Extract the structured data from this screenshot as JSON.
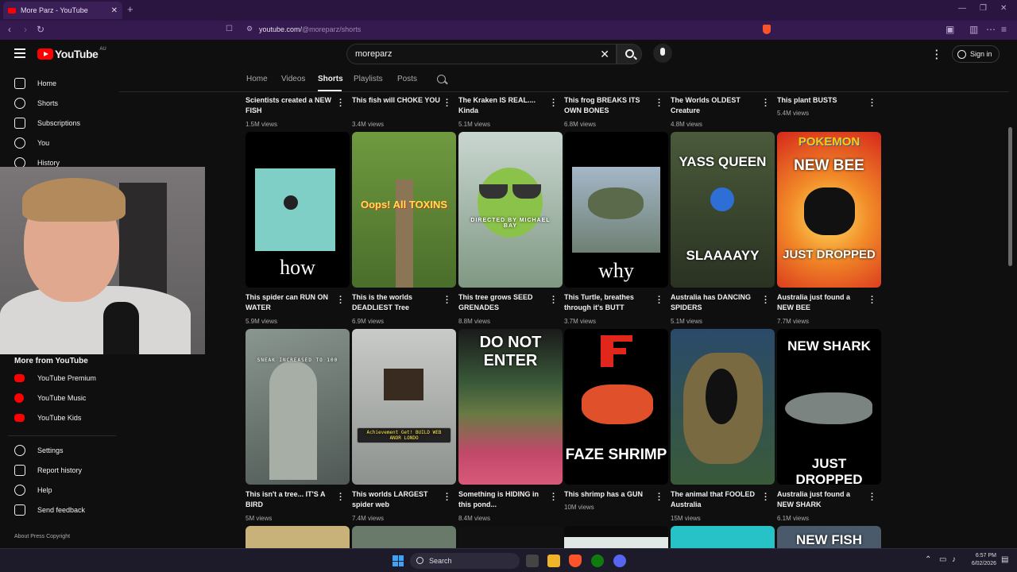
{
  "browser": {
    "tab_title": "More Parz - YouTube",
    "url_host": "youtube.com/",
    "url_path": "@moreparz/shorts"
  },
  "header": {
    "logo_text": "YouTube",
    "region": "AU",
    "search_value": "moreparz",
    "signin_label": "Sign in"
  },
  "sidebar": {
    "items": [
      {
        "label": "Home"
      },
      {
        "label": "Shorts"
      },
      {
        "label": "Subscriptions"
      },
      {
        "label": "You"
      },
      {
        "label": "History"
      }
    ],
    "more_heading": "More from YouTube",
    "more_items": [
      {
        "label": "YouTube Premium"
      },
      {
        "label": "YouTube Music"
      },
      {
        "label": "YouTube Kids"
      }
    ],
    "bottom_items": [
      {
        "label": "Settings"
      },
      {
        "label": "Report history"
      },
      {
        "label": "Help"
      },
      {
        "label": "Send feedback"
      }
    ],
    "footer": "About  Press  Copyright"
  },
  "channel_tabs": [
    "Home",
    "Videos",
    "Shorts",
    "Playlists",
    "Posts"
  ],
  "active_tab": "Shorts",
  "row0": [
    {
      "title": "Scientists created a NEW FISH",
      "views": "1.5M views"
    },
    {
      "title": "This fish will CHOKE YOU",
      "views": "3.4M views"
    },
    {
      "title": "The Kraken IS REAL.... Kinda",
      "views": "5.1M views"
    },
    {
      "title": "This frog BREAKS ITS OWN BONES",
      "views": "6.8M views"
    },
    {
      "title": "The Worlds OLDEST Creature",
      "views": "4.8M views"
    },
    {
      "title": "This plant BUSTS",
      "views": "5.4M views"
    }
  ],
  "row1": [
    {
      "title": "This spider can RUN ON WATER",
      "views": "5.9M views",
      "overlay": "how"
    },
    {
      "title": "This is the worlds DEADLIEST Tree",
      "views": "6.9M views",
      "overlay": "Oops! All TOXINS"
    },
    {
      "title": "This tree grows SEED GRENADES",
      "views": "8.8M views",
      "overlay": "DIRECTED BY MICHAEL BAY"
    },
    {
      "title": "This Turtle, breathes through it's BUTT",
      "views": "3.7M views",
      "overlay": "why"
    },
    {
      "title": "Australia has DANCING SPIDERS",
      "views": "5.1M views",
      "overlay_top": "YASS QUEEN",
      "overlay_bottom": "SLAAAAYY"
    },
    {
      "title": "Australia just found a NEW BEE",
      "views": "7.7M views",
      "overlay_brand": "POKEMON",
      "overlay_top": "NEW BEE",
      "overlay_bottom": "JUST DROPPED"
    }
  ],
  "row2": [
    {
      "title": "This isn't a tree... IT'S A BIRD",
      "views": "5M views",
      "overlay": "SNEAK INCREASED TO 100"
    },
    {
      "title": "This worlds LARGEST spider web",
      "views": "7.4M views",
      "overlay": "Achievement Get! BUILD WEB ANOR LONDO"
    },
    {
      "title": "Something is HIDING in this pond...",
      "views": "8.4M views",
      "overlay": "DO NOT ENTER"
    },
    {
      "title": "This shrimp has a GUN",
      "views": "10M views",
      "overlay": "FAZE SHRIMP"
    },
    {
      "title": "The animal that FOOLED Australia",
      "views": "15M views"
    },
    {
      "title": "Australia just found a NEW SHARK",
      "views": "6.1M views",
      "overlay_top": "NEW SHARK",
      "overlay_bottom": "JUST DROPPED"
    }
  ],
  "row3_overlay": "NEW FISH",
  "taskbar": {
    "search_label": "Search",
    "time": "6:57 PM",
    "date": "6/02/2026"
  }
}
